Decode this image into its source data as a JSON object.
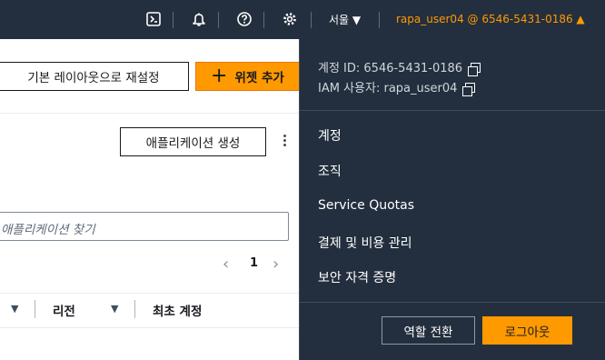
{
  "topbar": {
    "region_label": "서울 ▼",
    "account_label": "rapa_user04 @ 6546-5431-0186 ▲"
  },
  "dashboard": {
    "reset_layout_label": "기본 레이아웃으로 재설정",
    "add_widget_label": "위젯 추가",
    "create_app_label": "애플리케이션 생성",
    "search_placeholder": "애플리케이션 찾기",
    "page_number": "1",
    "columns": [
      "리전",
      "최초 계정"
    ]
  },
  "account_menu": {
    "account_id_label": "계정 ID: 6546-5431-0186",
    "iam_user_label": "IAM 사용자: rapa_user04",
    "items": [
      "계정",
      "조직",
      "Service Quotas",
      "결제 및 비용 관리",
      "보안 자격 증명"
    ],
    "switch_role_label": "역할 전환",
    "sign_out_label": "로그아웃"
  },
  "colors": {
    "navbar": "#232f3e",
    "accent": "#ff9900"
  }
}
